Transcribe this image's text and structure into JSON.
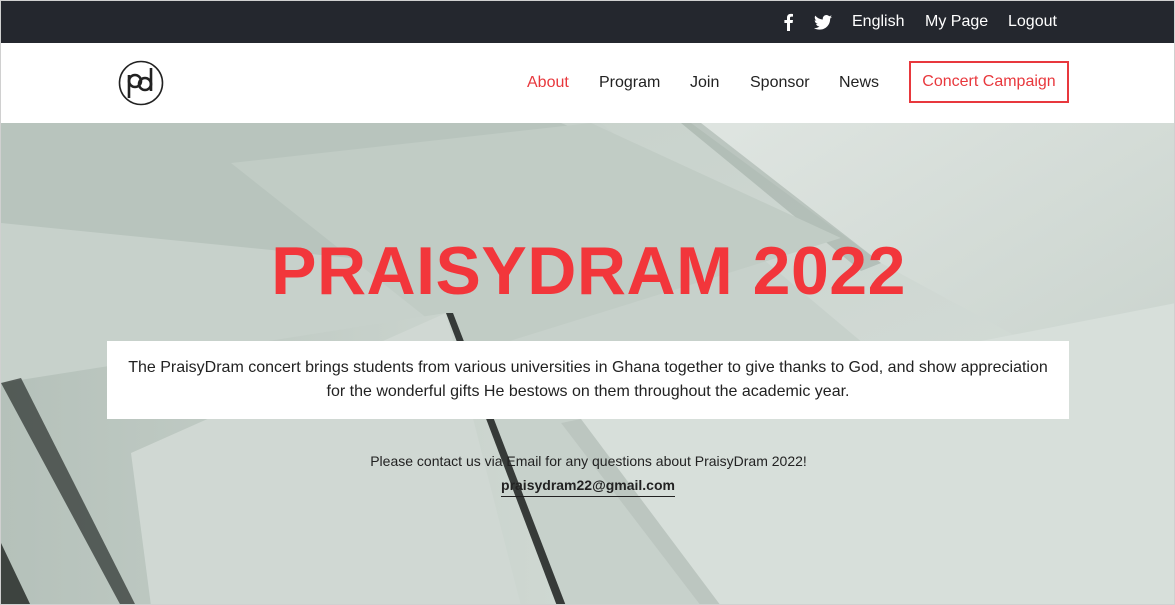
{
  "topbar": {
    "icons": [
      "facebook-icon",
      "twitter-icon"
    ],
    "links": {
      "english": "English",
      "my_page": "My Page",
      "logout": "Logout"
    }
  },
  "header": {
    "logo_text": "pd",
    "nav": {
      "about": "About",
      "program": "Program",
      "join": "Join",
      "sponsor": "Sponsor",
      "news": "News",
      "campaign": "Concert Campaign"
    },
    "active_item": "About"
  },
  "hero": {
    "title": "PRAISYDRAM 2022",
    "description": "The PraisyDram concert brings students from various universities in Ghana together to give thanks to God, and show appreciation for the wonderful gifts He bestows on them throughout the academic year.",
    "contact_text": "Please contact us via Email for any questions about PraisyDram 2022!",
    "contact_email": "praisydram22@gmail.com"
  },
  "colors": {
    "accent": "#e8383d",
    "topbar_bg": "#24272e",
    "hero_bg": "#c9d3cd"
  }
}
